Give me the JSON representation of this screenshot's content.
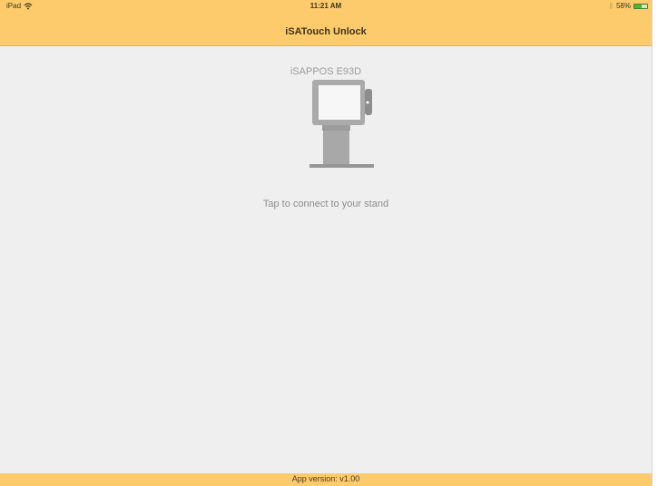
{
  "status_bar": {
    "device": "iPad",
    "time": "11:21 AM",
    "battery_text": "58%",
    "battery_level": 0.58,
    "wifi_icon": "wifi-icon",
    "bluetooth_icon": "bluetooth-icon"
  },
  "header": {
    "title": "iSATouch Unlock"
  },
  "main": {
    "device_name": "iSAPPOS E93D",
    "instruction": "Tap to connect to your stand",
    "stand_icon": "tablet-stand-icon"
  },
  "footer": {
    "version": "App version: v1.00"
  },
  "colors": {
    "accent_bar": "#fdcb6b",
    "background": "#efefef",
    "text_secondary": "#9d9d9d"
  }
}
